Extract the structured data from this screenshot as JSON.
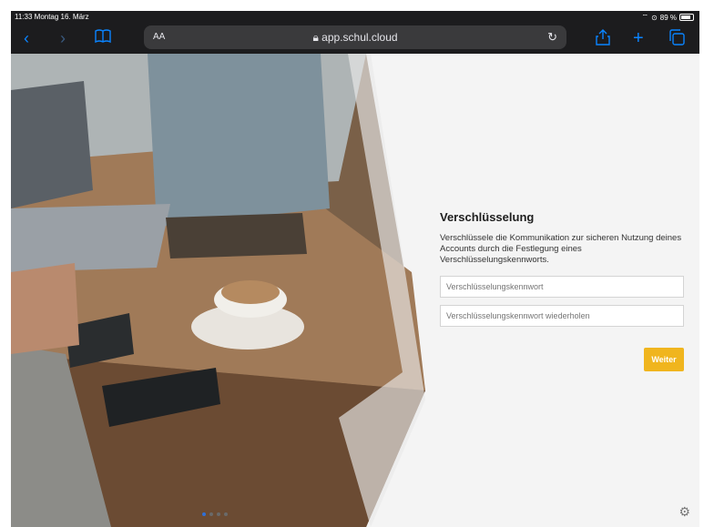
{
  "status_bar": {
    "time_date": "11:33  Montag 16. März",
    "battery_text": "89 %"
  },
  "browser": {
    "text_size_label": "AA",
    "url": "app.schul.cloud"
  },
  "form": {
    "heading": "Verschlüsselung",
    "description": "Verschlüssele die Kommunikation zur sicheren Nutzung deines Accounts durch die Festlegung eines Verschlüsselungskennworts.",
    "password_placeholder": "Verschlüsselungskennwort",
    "password_repeat_placeholder": "Verschlüsselungskennwort wiederholen",
    "submit_label": "Weiter"
  },
  "carousel": {
    "pages": 4,
    "active_index": 0
  },
  "colors": {
    "accent": "#0a84ff",
    "button": "#f0b51e"
  }
}
